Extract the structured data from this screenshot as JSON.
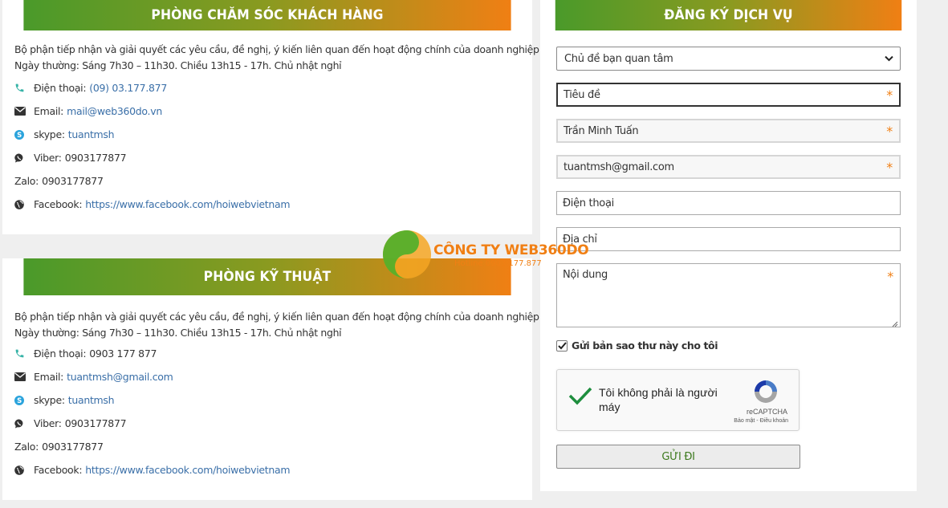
{
  "customer_care": {
    "title": "PHÒNG CHĂM SÓC KHÁCH HÀNG",
    "intro_line1": "Bộ phận tiếp nhận và giải quyết các yêu cầu, đề nghị, ý kiến liên quan đến hoạt động chính của doanh nghiệp",
    "intro_line2": "Ngày thường: Sáng 7h30 – 11h30. Chiều 13h15 - 17h. Chủ nhật nghỉ",
    "phone_label": "Điện thoại:",
    "phone_value": "(09) 03.177.877",
    "email_label": "Email:",
    "email_value": "mail@web360do.vn",
    "skype_label": "skype:",
    "skype_value": "tuantmsh",
    "viber_label": "Viber:",
    "viber_value": "0903177877",
    "zalo_label": "Zalo:",
    "zalo_value": "0903177877",
    "facebook_label": "Facebook:",
    "facebook_value": "https://www.facebook.com/hoiwebvietnam"
  },
  "technical": {
    "title": "PHÒNG KỸ THUẬT",
    "intro_line1": "Bộ phận tiếp nhận và giải quyết các yêu cầu, đề nghị, ý kiến liên quan đến hoạt động chính của doanh nghiệp",
    "intro_line2": "Ngày thường: Sáng 7h30 – 11h30. Chiều 13h15 - 17h. Chủ nhật nghỉ",
    "phone_label": "Điện thoại:",
    "phone_value": "0903 177 877",
    "email_label": "Email:",
    "email_value": "tuantmsh@gmail.com",
    "skype_label": "skype:",
    "skype_value": "tuantmsh",
    "viber_label": "Viber:",
    "viber_value": "0903177877",
    "zalo_label": "Zalo:",
    "zalo_value": "0903177877",
    "facebook_label": "Facebook:",
    "facebook_value": "https://www.facebook.com/hoiwebvietnam"
  },
  "register": {
    "title": "ĐĂNG KÝ DỊCH VỤ",
    "topic_select": "Chủ đề bạn quan tâm",
    "subject_field": "Tiêu đề",
    "name_field": "Trần Minh Tuấn",
    "email_field": "tuantmsh@gmail.com",
    "phone_field": "Điện thoại",
    "address_field": "Địa chỉ",
    "content_field": "Nội dung",
    "required_mark": "*",
    "copy_checkbox_label": "Gửi bản sao thư này cho tôi",
    "copy_checked": true,
    "captcha_text": "Tôi không phải là người máy",
    "captcha_brand": "reCAPTCHA",
    "captcha_terms": "Bảo mật - Điều khoản",
    "submit_label": "GỬI ĐI"
  },
  "watermark": {
    "name": "CÔNG TY WEB360DO",
    "hotline": "Hotline 0903.177.877"
  },
  "colors": {
    "header_green": "#4a9a2a",
    "header_orange": "#f07f14",
    "link": "#3a6fa8",
    "required": "#f07f14",
    "submit_text": "#3d7a1e"
  },
  "icons": {
    "phone": "phone-icon",
    "email": "envelope-icon",
    "skype": "skype-icon",
    "viber": "viber-icon",
    "facebook": "globe-icon"
  }
}
